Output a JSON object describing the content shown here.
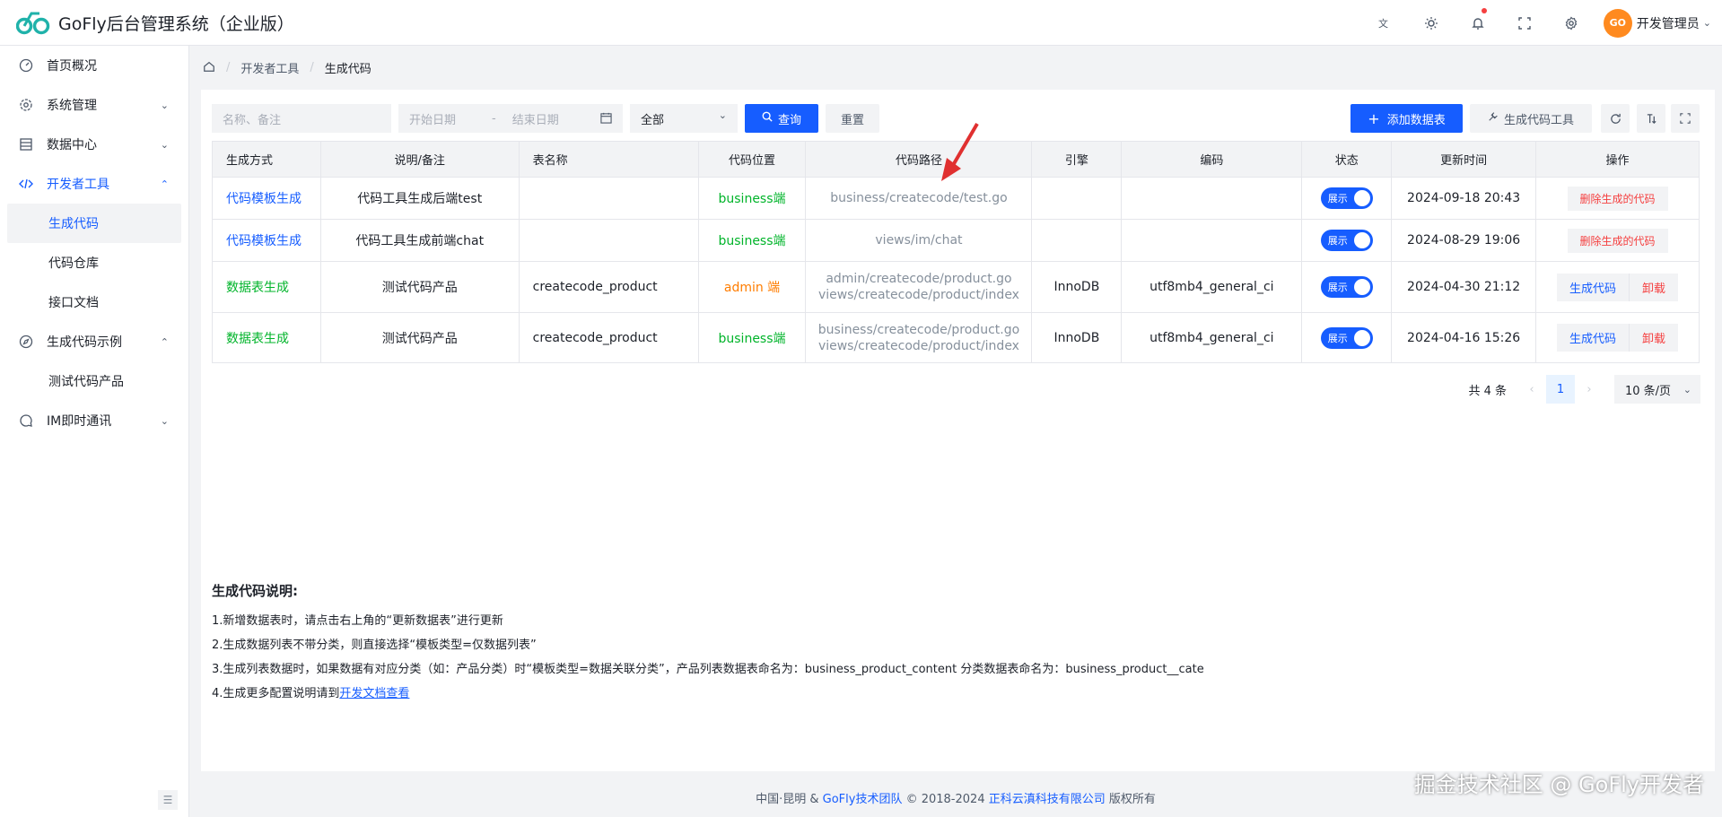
{
  "app": {
    "title": "GoFly后台管理系统（企业版）"
  },
  "header": {
    "icons": [
      "translate-icon",
      "theme-icon",
      "bell-icon",
      "fullscreen-icon",
      "settings-icon"
    ],
    "user": {
      "avatar_text": "GO",
      "name": "开发管理员"
    }
  },
  "sidebar": {
    "items": [
      {
        "label": "首页概况",
        "icon": "dashboard-icon"
      },
      {
        "label": "系统管理",
        "icon": "gear-icon",
        "chevron": "down"
      },
      {
        "label": "数据中心",
        "icon": "database-icon",
        "chevron": "down"
      },
      {
        "label": "开发者工具",
        "icon": "code-icon",
        "chevron": "up",
        "active": true
      },
      {
        "label": "生成代码示例",
        "icon": "compass-icon",
        "chevron": "up"
      },
      {
        "label": "IM即时通讯",
        "icon": "chat-icon",
        "chevron": "down"
      }
    ],
    "dev_sub": [
      "生成代码",
      "代码仓库",
      "接口文档"
    ],
    "example_sub": [
      "测试代码产品"
    ]
  },
  "breadcrumb": {
    "items": [
      "开发者工具",
      "生成代码"
    ]
  },
  "toolbar": {
    "search_placeholder": "名称、备注",
    "start_date_placeholder": "开始日期",
    "date_sep": "-",
    "end_date_placeholder": "结束日期",
    "select_value": "全部",
    "query_label": "查询",
    "reset_label": "重置",
    "add_table_label": "添加数据表",
    "tool_label": "生成代码工具"
  },
  "table": {
    "columns": [
      "生成方式",
      "说明/备注",
      "表名称",
      "代码位置",
      "代码路径",
      "引擎",
      "编码",
      "状态",
      "更新时间",
      "操作"
    ],
    "rows": [
      {
        "method": "代码模板生成",
        "remark": "代码工具生成后端test",
        "table_name": "",
        "position": "business端",
        "path1": "business/createcode/test.go",
        "path2": "",
        "engine": "",
        "charset": "",
        "status": "展示",
        "updated": "2024-09-18 20:43",
        "op": "删除生成的代码"
      },
      {
        "method": "代码模板生成",
        "remark": "代码工具生成前端chat",
        "table_name": "",
        "position": "business端",
        "path1": "views/im/chat",
        "path2": "",
        "engine": "",
        "charset": "",
        "status": "展示",
        "updated": "2024-08-29 19:06",
        "op": "删除生成的代码"
      },
      {
        "method": "数据表生成",
        "remark": "测试代码产品",
        "table_name": "createcode_product",
        "position": "admin 端",
        "path1": "admin/createcode/product.go",
        "path2": "views/createcode/product/index",
        "engine": "InnoDB",
        "charset": "utf8mb4_general_ci",
        "status": "展示",
        "updated": "2024-04-30 21:12",
        "op1": "生成代码",
        "op2": "卸载"
      },
      {
        "method": "数据表生成",
        "remark": "测试代码产品",
        "table_name": "createcode_product",
        "position": "business端",
        "path1": "business/createcode/product.go",
        "path2": "views/createcode/product/index",
        "engine": "InnoDB",
        "charset": "utf8mb4_general_ci",
        "status": "展示",
        "updated": "2024-04-16 15:26",
        "op1": "生成代码",
        "op2": "卸载"
      }
    ]
  },
  "pagination": {
    "total": "共 4 条",
    "current": "1",
    "page_size": "10 条/页"
  },
  "notes": {
    "title": "生成代码说明:",
    "line1": "1.新增数据表时，请点击右上角的“更新数据表”进行更新",
    "line2": "2.生成数据列表不带分类，则直接选择“模板类型=仅数据列表”",
    "line3": "3.生成列表数据时，如果数据有对应分类（如：产品分类）时“模板类型=数据关联分类”，产品列表数据表命名为：business_product_content 分类数据表命名为：business_product__cate",
    "line4_prefix": "4.生成更多配置说明请到",
    "line4_link": "开发文档查看"
  },
  "footer": {
    "prefix": "中国·昆明 &",
    "team": "GoFly技术团队",
    "copyright": "© 2018-2024",
    "company": "正科云滇科技有限公司",
    "suffix": "版权所有"
  },
  "watermark": "掘金技术社区 @ GoFly开发者",
  "colors": {
    "primary": "#165dff",
    "danger": "#f53f3f",
    "success": "#00b42a",
    "warning": "#ff7d00"
  }
}
